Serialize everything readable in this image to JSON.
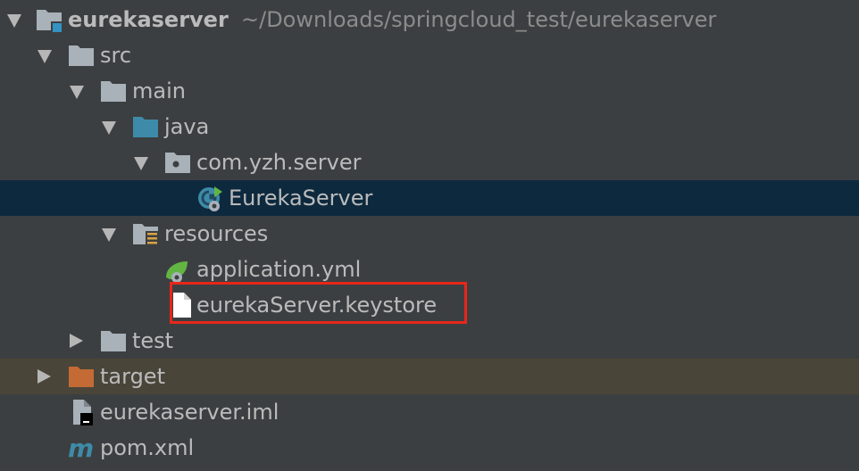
{
  "project_tree": {
    "root": {
      "name": "eurekaserver",
      "path": "~/Downloads/springcloud_test/eurekaserver"
    },
    "items": [
      {
        "label": "src"
      },
      {
        "label": "main"
      },
      {
        "label": "java"
      },
      {
        "label": "com.yzh.server"
      },
      {
        "label": "EurekaServer"
      },
      {
        "label": "resources"
      },
      {
        "label": "application.yml"
      },
      {
        "label": "eurekaServer.keystore"
      },
      {
        "label": "test"
      },
      {
        "label": "target"
      },
      {
        "label": "eurekaserver.iml"
      },
      {
        "label": "pom.xml"
      }
    ]
  },
  "colors": {
    "background": "#3c3f41",
    "selected_row": "#0d293e",
    "excluded_row": "#4a4539",
    "highlight": "#e8261a",
    "folder": "#a9b1b9",
    "source_folder": "#3d8ba8",
    "excluded_folder": "#c36a35"
  },
  "icons": {
    "module": "module-folder-icon",
    "folder": "folder-icon",
    "source_folder": "source-folder-icon",
    "package": "package-icon",
    "class": "spring-boot-class-icon",
    "resources": "resources-folder-icon",
    "yml": "spring-yml-icon",
    "file": "file-icon",
    "iml": "iml-file-icon",
    "maven": "maven-icon"
  }
}
